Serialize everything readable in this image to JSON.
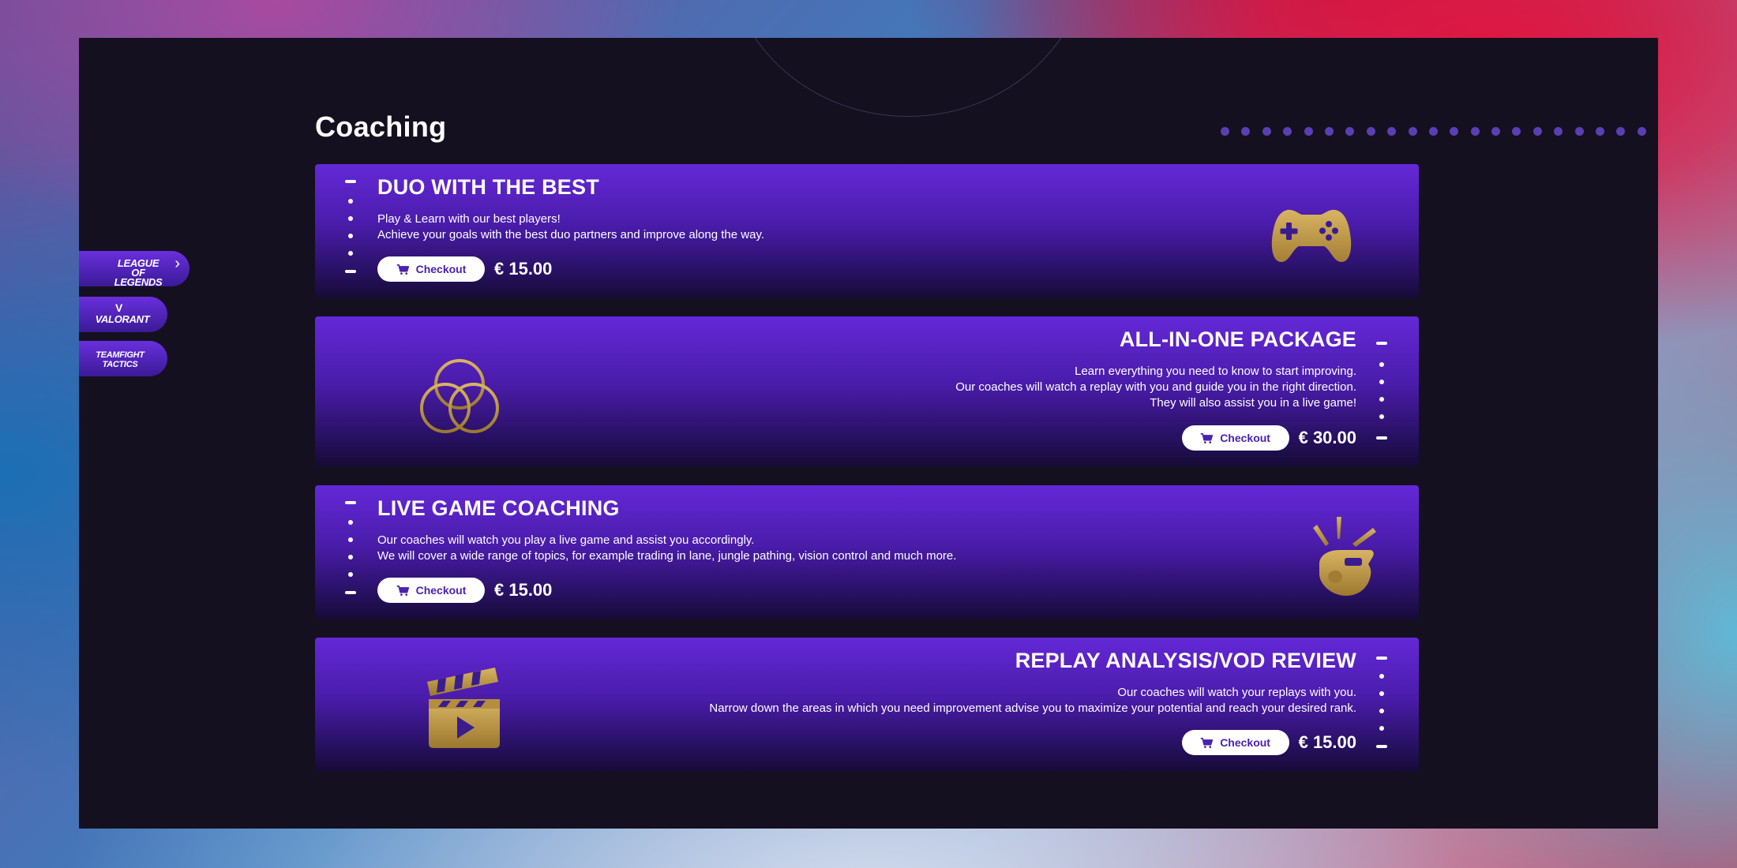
{
  "page": {
    "title": "Coaching"
  },
  "sidebar": {
    "tabs": [
      {
        "label": "LEAGUE OF LEGENDS",
        "active": true
      },
      {
        "label": "VALORANT",
        "active": false
      },
      {
        "label": "TEAMFIGHT TACTICS",
        "active": false
      }
    ]
  },
  "services": [
    {
      "title": "DUO WITH THE BEST",
      "lines": [
        "Play & Learn with our best players!",
        "Achieve your goals with the best duo partners and improve along the way."
      ],
      "checkout_label": "Checkout",
      "price": "€ 15.00",
      "icon": "gamepad-icon",
      "align": "left"
    },
    {
      "title": "ALL-IN-ONE PACKAGE",
      "lines": [
        "Learn everything you need to know to start improving.",
        "Our coaches will watch a replay with you and guide you in the right direction.",
        "They will also assist you in a live game!"
      ],
      "checkout_label": "Checkout",
      "price": "€ 30.00",
      "icon": "interlocking-circles-icon",
      "align": "right"
    },
    {
      "title": "LIVE GAME COACHING",
      "lines": [
        "Our coaches will watch you play a live game and assist you accordingly.",
        "We will cover a wide range of topics, for example trading in lane, jungle pathing, vision control and much more."
      ],
      "checkout_label": "Checkout",
      "price": "€ 15.00",
      "icon": "whistle-icon",
      "align": "left"
    },
    {
      "title": "REPLAY ANALYSIS/VOD REVIEW",
      "lines": [
        "Our coaches will watch your replays with you.",
        "Narrow down the areas in which you need improvement advise you to maximize your potential and reach your desired rank."
      ],
      "checkout_label": "Checkout",
      "price": "€ 15.00",
      "icon": "clapperboard-icon",
      "align": "right"
    }
  ],
  "colors": {
    "frame_bg": "#14101f",
    "card_top": "#6428d8",
    "card_bottom": "#160b36",
    "gold_icon": "#c9a24e",
    "dot_accent": "#5a3fb4"
  }
}
